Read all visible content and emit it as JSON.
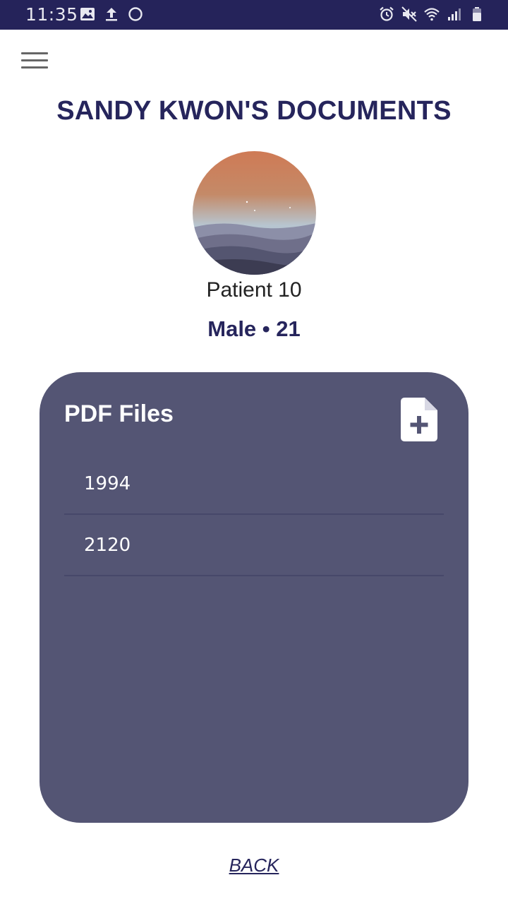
{
  "status_bar": {
    "time": "11:35",
    "left_icons": [
      "image-icon",
      "upload-icon",
      "circle-icon"
    ],
    "right_icons": [
      "alarm-icon",
      "mute-icon",
      "wifi-icon",
      "signal-icon",
      "battery-icon"
    ]
  },
  "header": {
    "title": "SANDY KWON'S DOCUMENTS"
  },
  "patient": {
    "name": "Patient 10",
    "meta": "Male • 21"
  },
  "documents": {
    "title": "PDF Files",
    "add_icon": "add-file-icon",
    "files": [
      {
        "name": "1994"
      },
      {
        "name": "2120"
      }
    ]
  },
  "footer": {
    "back_label": "BACK"
  },
  "colors": {
    "status_bar": "#25235a",
    "title": "#26255c",
    "card": "#545574"
  }
}
